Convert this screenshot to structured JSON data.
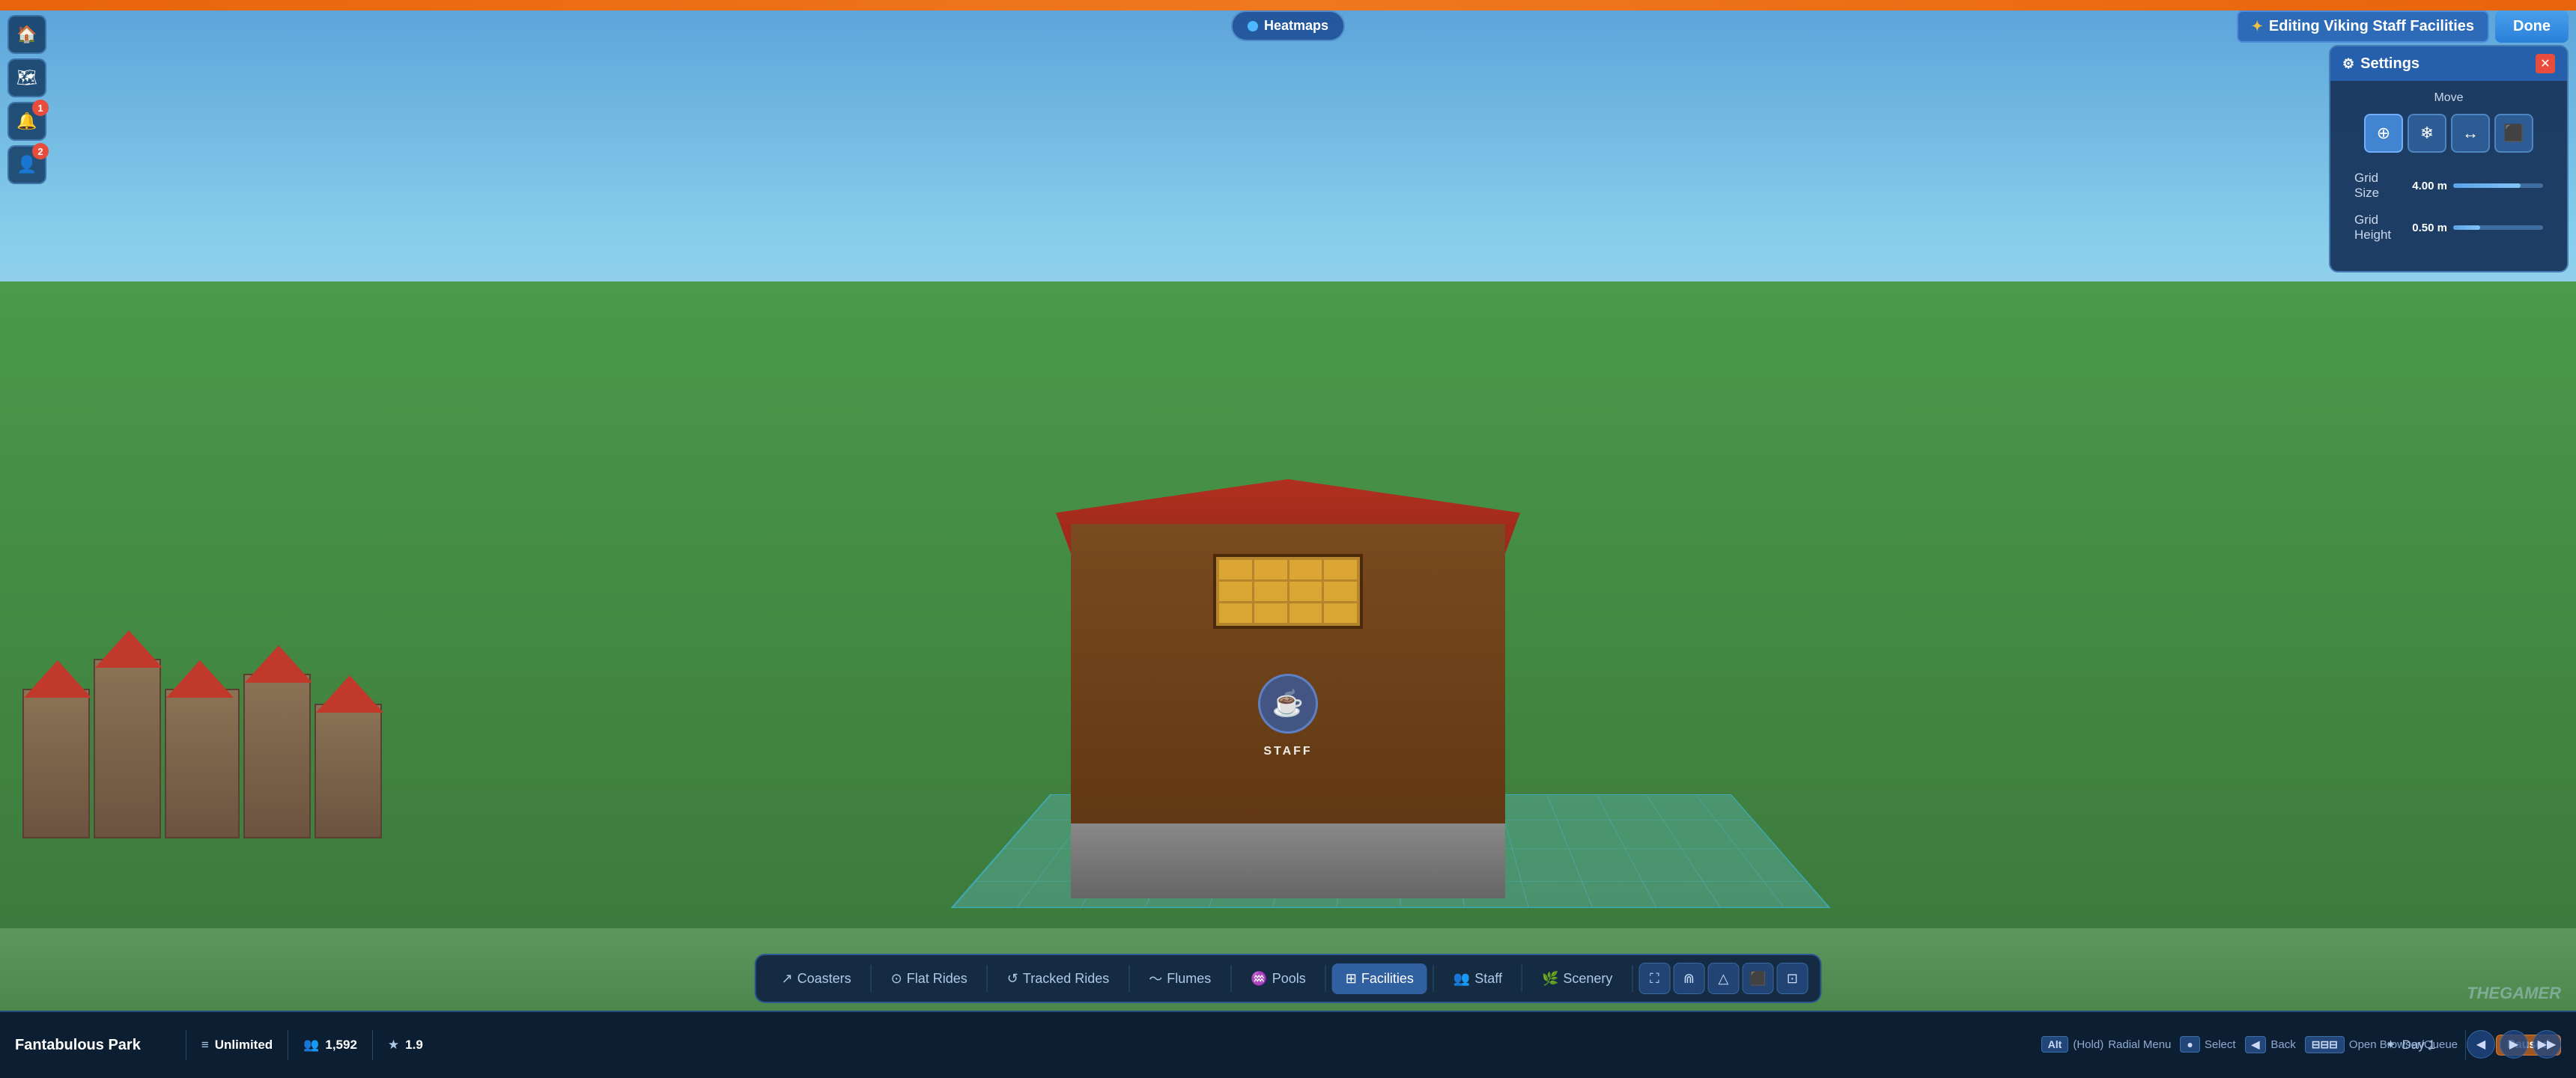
{
  "header": {
    "bar_color": "#e8640a"
  },
  "heatmaps": {
    "label": "Heatmaps"
  },
  "editing": {
    "label": "Editing Viking Staff Facilities",
    "icon": "✦",
    "done_label": "Done"
  },
  "hud_buttons": [
    {
      "icon": "🏠",
      "name": "home",
      "badge": null
    },
    {
      "icon": "🗺",
      "name": "map",
      "badge": null
    },
    {
      "icon": "🔔",
      "name": "notifications",
      "badge": "1"
    },
    {
      "icon": "👤",
      "name": "profile",
      "badge": "2"
    }
  ],
  "settings": {
    "title": "Settings",
    "move_label": "Move",
    "move_buttons": [
      {
        "icon": "⊕",
        "name": "move-all",
        "active": true
      },
      {
        "icon": "❄",
        "name": "freeze",
        "active": false
      },
      {
        "icon": "↔",
        "name": "move-horizontal",
        "active": false
      },
      {
        "icon": "⬛",
        "name": "snap",
        "active": false
      }
    ],
    "grid_size_label": "Grid Size",
    "grid_size_value": "4.00 m",
    "grid_size_percent": 75,
    "grid_height_label": "Grid Height",
    "grid_height_value": "0.50 m",
    "grid_height_percent": 30
  },
  "toolbar": {
    "items": [
      {
        "label": "Coasters",
        "icon": "↗",
        "active": false
      },
      {
        "label": "Flat Rides",
        "icon": "⊙",
        "active": false
      },
      {
        "label": "Tracked Rides",
        "icon": "↺",
        "active": false
      },
      {
        "label": "Flumes",
        "icon": "〜",
        "active": false
      },
      {
        "label": "Pools",
        "icon": "♒",
        "active": false
      },
      {
        "label": "Facilities",
        "icon": "⊞",
        "active": true
      },
      {
        "label": "Staff",
        "icon": "👥",
        "active": false
      },
      {
        "label": "Scenery",
        "icon": "🌿",
        "active": false
      }
    ],
    "icon_buttons": [
      "⛶",
      "⋒",
      "△",
      "⬛",
      "⊡"
    ]
  },
  "status_bar": {
    "park_name": "Fantabulous Park",
    "budget_icon": "≡",
    "budget_label": "Unlimited",
    "guests_icon": "👥",
    "guests_count": "1,592",
    "rating_icon": "★",
    "rating": "1.9",
    "day_icon": "✦",
    "day_label": "Day 1",
    "paused_label": "Paused"
  },
  "bottom_controls": {
    "radial_menu_key": "Alt",
    "radial_menu_hold": "(Hold)",
    "radial_menu_label": "Radial Menu",
    "select_label": "Select",
    "back_label": "Back",
    "open_browser_label": "Open Browser/Queue"
  },
  "watermark": "THEGAMER"
}
